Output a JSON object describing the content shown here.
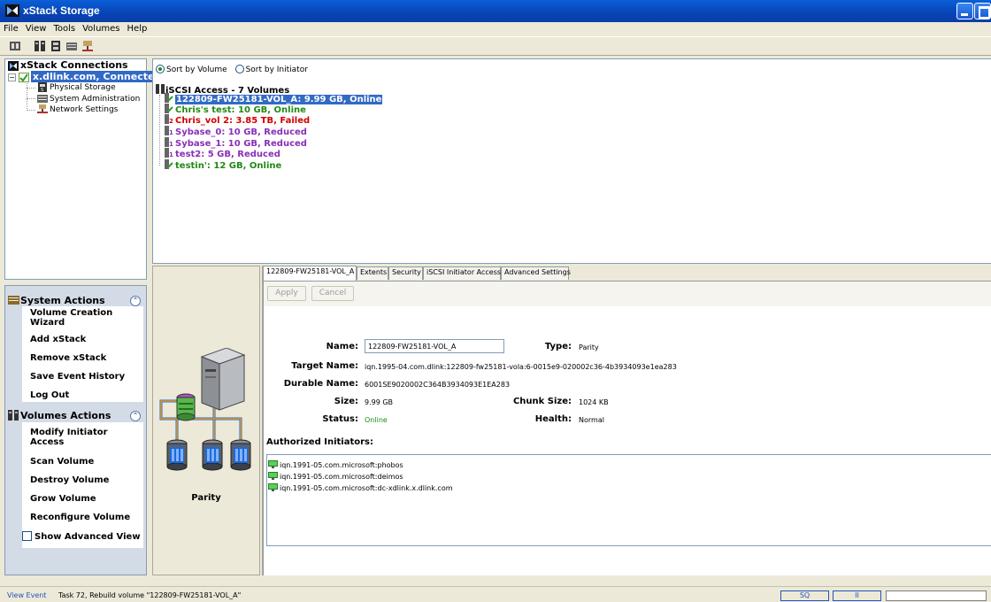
{
  "window": {
    "title": "xStack Storage"
  },
  "menu": [
    "File",
    "View",
    "Tools",
    "Volumes",
    "Help"
  ],
  "toolbar": {
    "icons": [
      "storage-icon",
      "volumes-icon",
      "physical-disk-icon",
      "server-icon",
      "network-icon"
    ]
  },
  "tree": {
    "root": "xStack Connections",
    "connection": "x.dlink.com, Connected",
    "children": [
      "Physical Storage",
      "System Administration",
      "Network Settings"
    ]
  },
  "system_actions": {
    "title": "System Actions",
    "items": [
      "Volume Creation\nWizard",
      "Add xStack",
      "Remove xStack",
      "Save Event History",
      "Log Out"
    ]
  },
  "volumes_actions": {
    "title": "Volumes Actions",
    "items": [
      "Modify Initiator\nAccess",
      "Scan Volume",
      "Destroy Volume",
      "Grow Volume",
      "Reconfigure Volume"
    ],
    "advanced_view": "Show Advanced View"
  },
  "sort": {
    "by_volume": "Sort by Volume",
    "by_initiator": "Sort by Initiator",
    "selected": "by_volume"
  },
  "volume_list": {
    "root": "iSCSI Access - 7 Volumes",
    "items": [
      {
        "label": "122809-FW25181-VOL_A: 9.99 GB, Online",
        "status": "online",
        "selected": true
      },
      {
        "label": "Chris's test: 10 GB, Online",
        "status": "online"
      },
      {
        "label": "Chris_vol 2: 3.85 TB, Failed",
        "status": "failed"
      },
      {
        "label": "Sybase_0: 10 GB, Reduced",
        "status": "reduced"
      },
      {
        "label": "Sybase_1: 10 GB, Reduced",
        "status": "reduced"
      },
      {
        "label": "test2: 5 GB, Reduced",
        "status": "reduced"
      },
      {
        "label": "testin': 12 GB, Online",
        "status": "online"
      }
    ]
  },
  "image_panel": {
    "label": "Parity"
  },
  "tabs": [
    "122809-FW25181-VOL_A",
    "Extents",
    "Security",
    "iSCSI Initiator Access",
    "Advanced Settings"
  ],
  "buttons": {
    "apply": "Apply",
    "cancel": "Cancel"
  },
  "details": {
    "name_label": "Name:",
    "name_value": "122809-FW25181-VOL_A",
    "type_label": "Type:",
    "type_value": "Parity",
    "target_label": "Target Name:",
    "target_value": "iqn.1995-04.com.dlink:122809-fw25181-vola:6-0015e9-020002c36-4b3934093e1ea283",
    "durable_label": "Durable Name:",
    "durable_value": "6001SE9020002C364B3934093E1EA283",
    "size_label": "Size:",
    "size_value": "9.99 GB",
    "chunk_label": "Chunk Size:",
    "chunk_value": "1024 KB",
    "status_label": "Status:",
    "status_value": "Online",
    "health_label": "Health:",
    "health_value": "Normal"
  },
  "initiators": {
    "title": "Authorized Initiators:",
    "items": [
      "iqn.1991-05.com.microsoft:phobos",
      "iqn.1991-05.com.microsoft:deimos",
      "iqn.1991-05.com.microsoft:dc-xdlink.x.dlink.com"
    ]
  },
  "statusbar": {
    "view_event": "View Event",
    "task": "Task 72, Rebuild volume \"122809-FW25181-VOL_A\"",
    "box1": "SQ",
    "box2": "II"
  },
  "colors": {
    "online": "#1f8a12",
    "failed": "#d20000",
    "reduced": "#8a2fb5",
    "selection": "#316ac5",
    "titlebar": "#0843b4"
  }
}
